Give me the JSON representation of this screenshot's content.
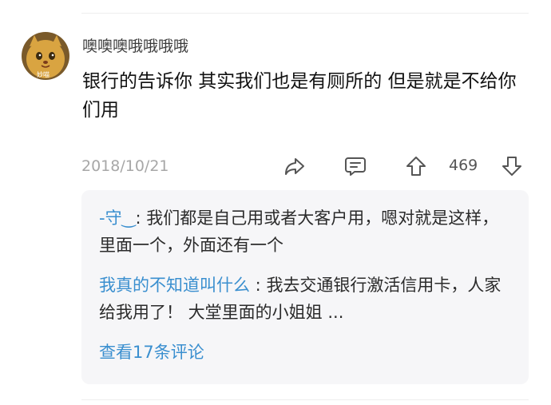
{
  "comment": {
    "username": "噢噢噢哦哦哦哦",
    "avatar_icon": "cartoon-cat-avatar",
    "avatar_caption": "妙喵",
    "text": "银行的告诉你 其实我们也是有厕所的 但是就是不给你们用",
    "timestamp": "2018/10/21",
    "like_count": "469",
    "icons": {
      "share": "share-arrow-icon",
      "comment": "comment-bubble-icon",
      "upvote": "thumb-up-arrow-icon",
      "downvote": "thumb-down-arrow-icon"
    }
  },
  "replies": [
    {
      "author": "-守‿",
      "separator": ": ",
      "text": "我们都是自己用或者大客户用，嗯对就是这样，里面一个，外面还有一个"
    },
    {
      "author": "我真的不知道叫什么",
      "separator": " : ",
      "text": "我去交通银行激活信用卡，人家给我用了！ 大堂里面的小姐姐 ..."
    }
  ],
  "view_more_label": "查看17条评论",
  "colors": {
    "link": "#3a8fcf",
    "muted": "#a7a7a7",
    "reply_bg": "#f6f6f8"
  }
}
